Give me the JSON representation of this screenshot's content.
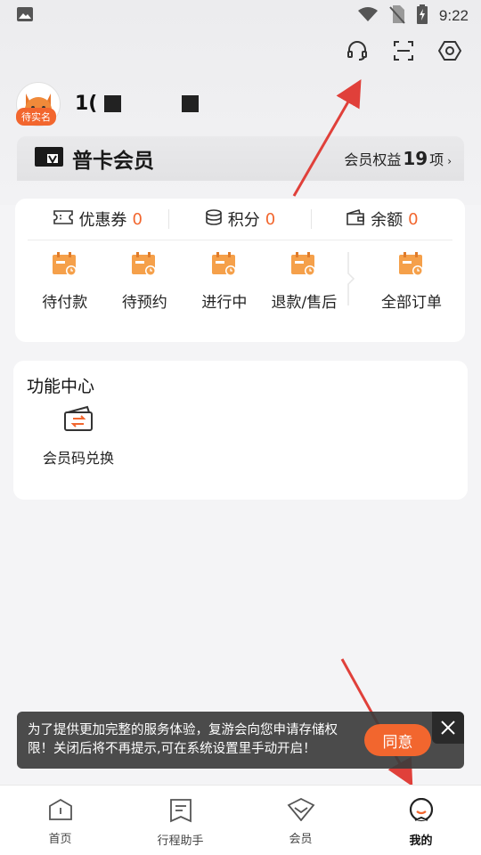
{
  "status_bar": {
    "time": "9:22"
  },
  "header": {
    "icons": [
      "headset-icon",
      "scan-icon",
      "settings-icon"
    ]
  },
  "profile": {
    "verify_badge": "待实名",
    "username_visible": "1("
  },
  "member_card": {
    "title": "普卡会员",
    "rights_label": "会员权益",
    "rights_count": "19",
    "rights_unit": "项"
  },
  "assets": {
    "items": [
      {
        "label": "优惠券",
        "value": "0",
        "icon": "coupon-icon"
      },
      {
        "label": "积分",
        "value": "0",
        "icon": "points-coin-icon"
      },
      {
        "label": "余额",
        "value": "0",
        "icon": "wallet-icon"
      }
    ]
  },
  "orders": {
    "items": [
      {
        "label": "待付款"
      },
      {
        "label": "待预约"
      },
      {
        "label": "进行中"
      },
      {
        "label": "退款/售后"
      }
    ],
    "all_label": "全部订单"
  },
  "function_center": {
    "title": "功能中心",
    "items": [
      {
        "label": "会员码兑换",
        "icon": "exchange-ticket-icon"
      }
    ]
  },
  "toast": {
    "message": "为了提供更加完整的服务体验，复游会向您申请存储权限！关闭后将不再提示,可在系统设置里手动开启！",
    "agree_label": "同意"
  },
  "bottom_nav": {
    "items": [
      {
        "label": "首页",
        "icon": "home-icon"
      },
      {
        "label": "行程助手",
        "icon": "itinerary-icon"
      },
      {
        "label": "会员",
        "icon": "member-icon"
      },
      {
        "label": "我的",
        "icon": "profile-icon"
      }
    ],
    "active_index": 3
  },
  "colors": {
    "accent": "#f2662e",
    "toast_bg": "#3c3c3c",
    "arrow": "#e0403a"
  }
}
